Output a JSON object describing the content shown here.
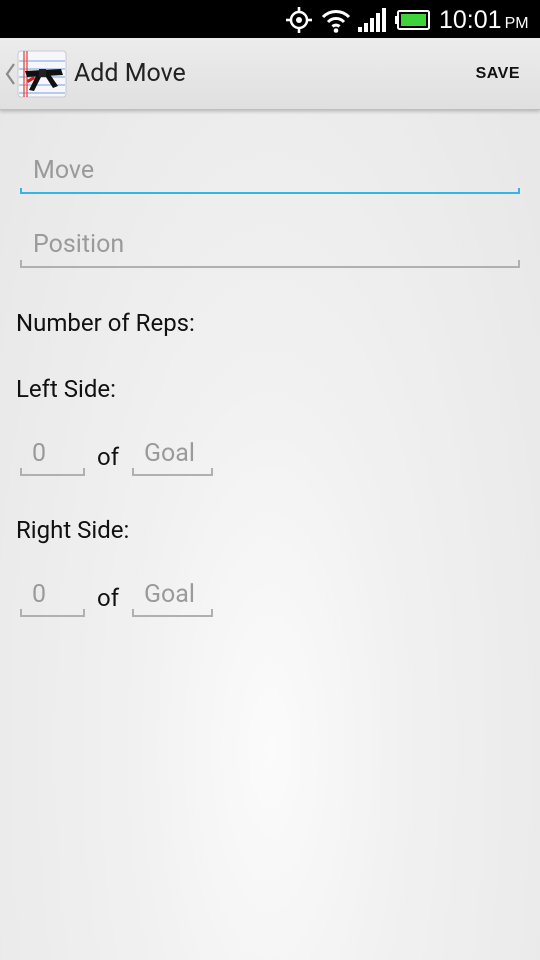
{
  "status_bar": {
    "time": "10:01",
    "ampm": "PM",
    "icons": [
      "gps-icon",
      "wifi-icon",
      "signal-icon",
      "battery-icon"
    ]
  },
  "action_bar": {
    "title": "Add Move",
    "save_label": "SAVE",
    "app_icon": "black-belt-notebook-icon",
    "back_icon": "chevron-left-icon"
  },
  "form": {
    "move": {
      "value": "",
      "placeholder": "Move"
    },
    "position": {
      "value": "",
      "placeholder": "Position"
    },
    "reps_label": "Number of Reps:",
    "left_side": {
      "label": "Left Side:",
      "count_placeholder": "0",
      "of_label": "of",
      "goal_placeholder": "Goal"
    },
    "right_side": {
      "label": "Right Side:",
      "count_placeholder": "0",
      "of_label": "of",
      "goal_placeholder": "Goal"
    }
  },
  "colors": {
    "focus_accent": "#33b5e5",
    "status_bar_bg": "#000000",
    "action_bar_bg": "#e6e6e6",
    "battery_green": "#3fd23a",
    "belt_red": "#d42424"
  }
}
